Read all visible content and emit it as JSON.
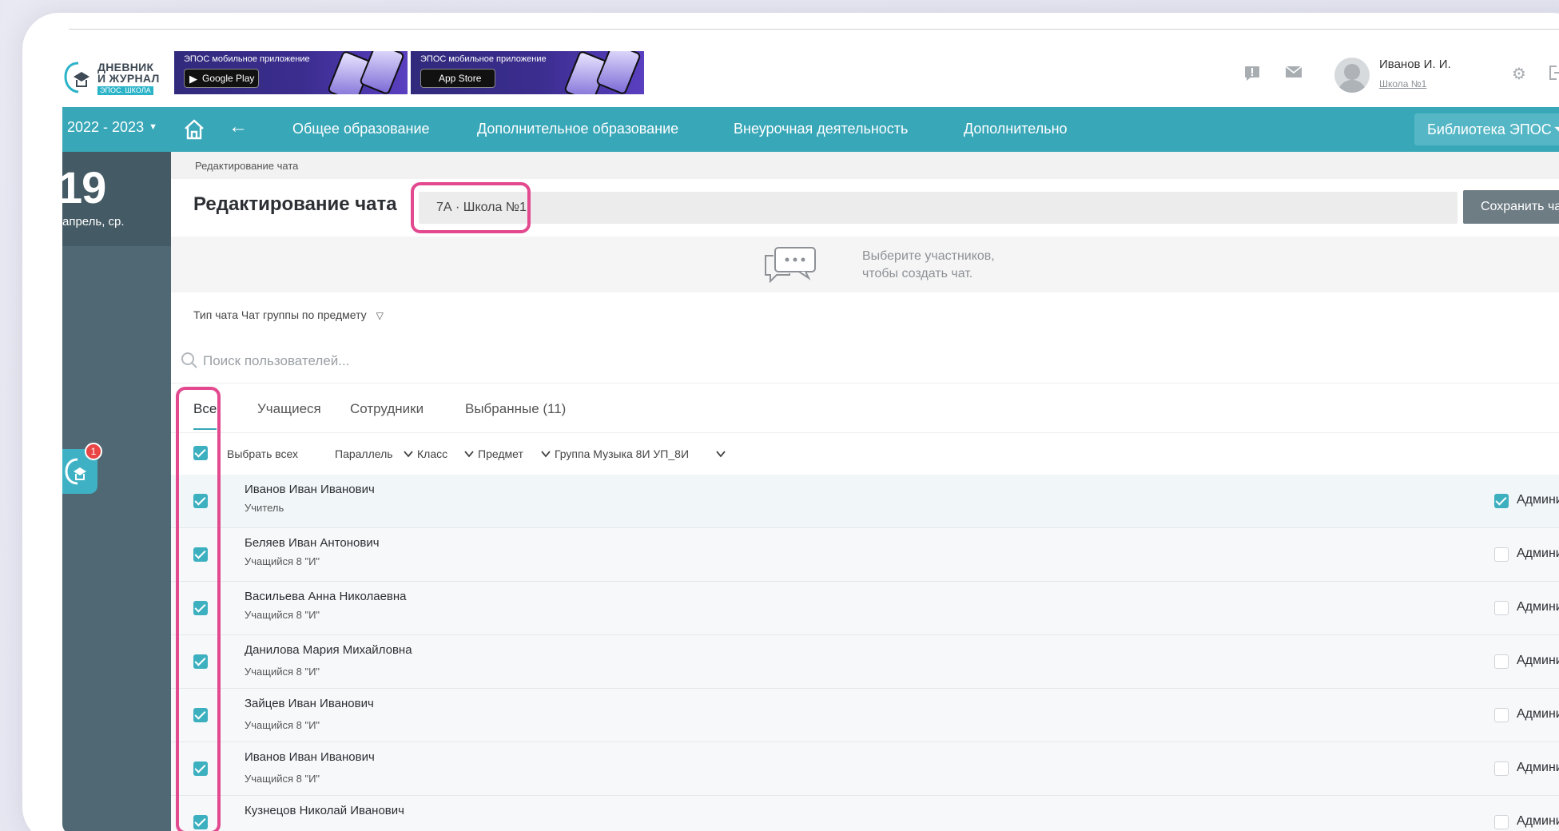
{
  "logo": {
    "line1": "ДНЕВНИК",
    "line2": "И ЖУРНАЛ",
    "sub": "ЭПОС. ШКОЛА"
  },
  "banners": [
    {
      "title": "ЭПОС мобильное приложение",
      "store": "Google Play",
      "store_icon": "google-play-icon"
    },
    {
      "title": "ЭПОС мобильное приложение",
      "store": "App Store",
      "store_icon": "apple-icon"
    }
  ],
  "user": {
    "name": "Иванов И. И.",
    "school": "Школа №1"
  },
  "nav": {
    "year": "2022 - 2023",
    "items": [
      "Общее образование",
      "Дополнительное образование",
      "Внеурочная деятельность",
      "Дополнительно"
    ],
    "library": "Библиотека ЭПОС"
  },
  "rail": {
    "day": "19",
    "month": "апрель, ср.",
    "badge": "1"
  },
  "breadcrumb": "Редактирование чата",
  "page": {
    "title": "Редактирование чата",
    "chat_name": "7А · Школа №1",
    "save": "Сохранить чат",
    "hint_line1": "Выберите участников,",
    "hint_line2": "чтобы создать чат.",
    "chat_type": "Тип чата Чат группы по предмету"
  },
  "search": {
    "placeholder": "Поиск пользователей..."
  },
  "tabs": [
    "Все",
    "Учащиеся",
    "Сотрудники",
    "Выбранные (11)"
  ],
  "filters": {
    "select_all": "Выбрать всех",
    "parallel": "Параллель",
    "class": "Класс",
    "subject": "Предмет",
    "group": "Группа Музыка 8И УП_8И"
  },
  "admin_label": "Администратор",
  "users": [
    {
      "name": "Иванов Иван Иванович",
      "role": "Учитель",
      "selected": true,
      "admin": true
    },
    {
      "name": "Беляев Иван Антонович",
      "role": "Учащийся 8 \"И\"",
      "selected": true,
      "admin": false
    },
    {
      "name": "Васильева Анна Николаевна",
      "role": "Учащийся 8 \"И\"",
      "selected": true,
      "admin": false
    },
    {
      "name": "Данилова Мария Михайловна",
      "role": "Учащийся 8 \"И\"",
      "selected": true,
      "admin": false
    },
    {
      "name": "Зайцев Иван Иванович",
      "role": "Учащийся 8 \"И\"",
      "selected": true,
      "admin": false
    },
    {
      "name": "Иванов Иван Иванович",
      "role": "Учащийся 8 \"И\"",
      "selected": true,
      "admin": false
    },
    {
      "name": "Кузнецов Николай Иванович",
      "role": "",
      "selected": true,
      "admin": false
    }
  ],
  "colors": {
    "accent": "#38a7b8",
    "highlight": "#e2498e",
    "rail": "#4f6873",
    "save_button": "#6e7c84"
  }
}
